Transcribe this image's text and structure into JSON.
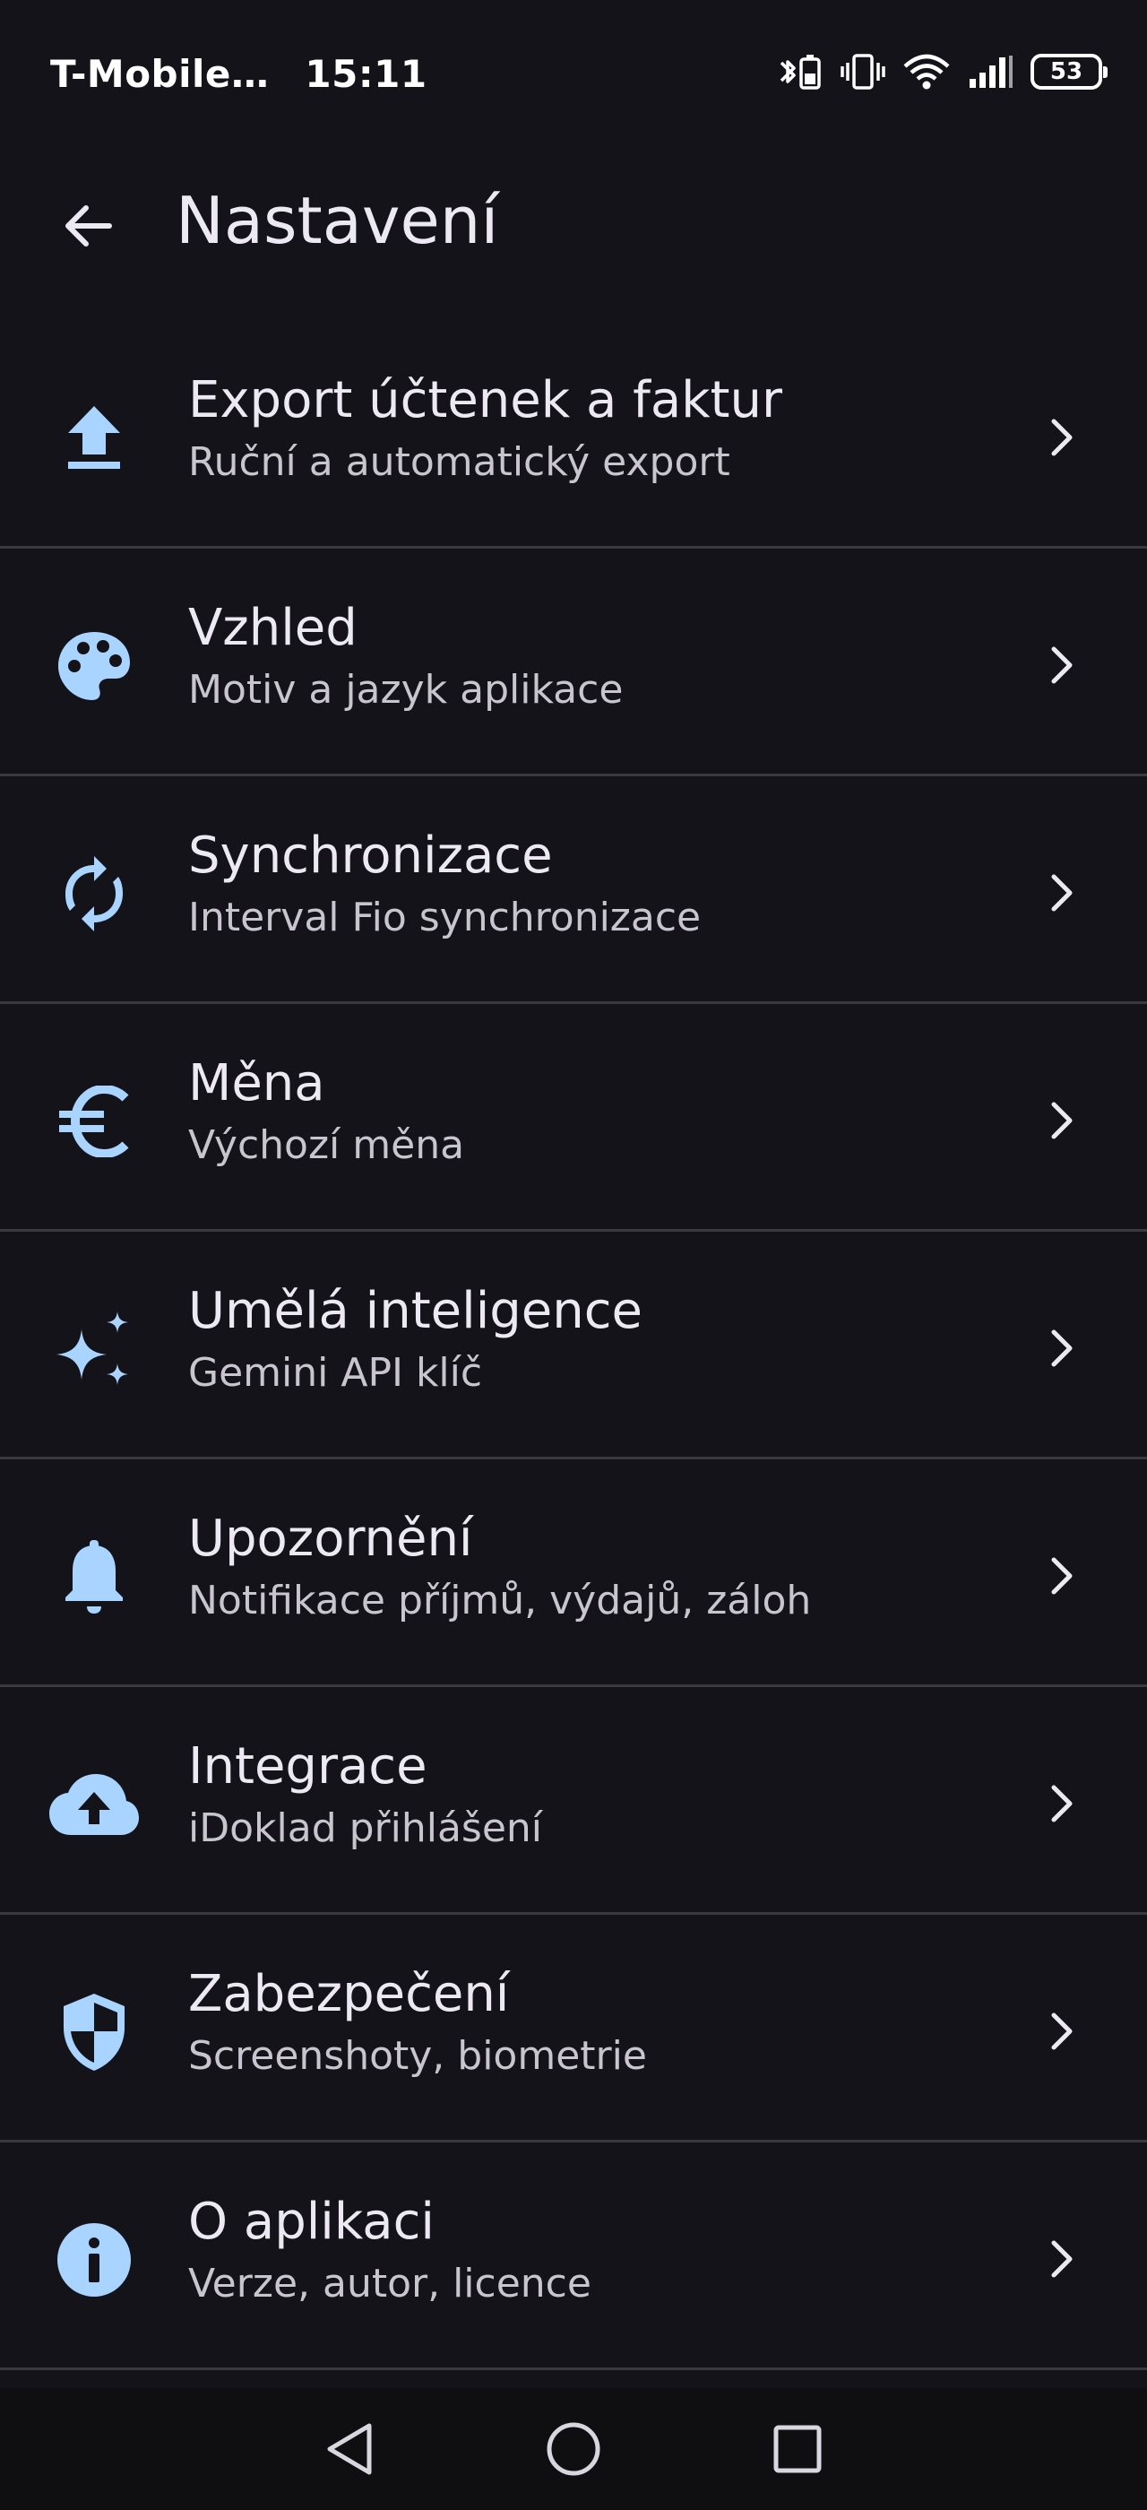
{
  "status_bar": {
    "carrier": "T-Mobile…",
    "time": "15:11",
    "battery": "53"
  },
  "app_bar": {
    "title": "Nastavení"
  },
  "settings": {
    "items": [
      {
        "title": "Export účtenek a faktur",
        "subtitle": "Ruční a automatický export",
        "icon": "upload-icon"
      },
      {
        "title": "Vzhled",
        "subtitle": "Motiv a jazyk aplikace",
        "icon": "palette-icon"
      },
      {
        "title": "Synchronizace",
        "subtitle": "Interval Fio synchronizace",
        "icon": "sync-icon"
      },
      {
        "title": "Měna",
        "subtitle": "Výchozí měna",
        "icon": "euro-icon"
      },
      {
        "title": "Umělá inteligence",
        "subtitle": "Gemini API klíč",
        "icon": "sparkles-icon"
      },
      {
        "title": "Upozornění",
        "subtitle": "Notifikace příjmů, výdajů, záloh",
        "icon": "bell-icon"
      },
      {
        "title": "Integrace",
        "subtitle": "iDoklad přihlášení",
        "icon": "cloud-upload-icon"
      },
      {
        "title": "Zabezpečení",
        "subtitle": "Screenshoty, biometrie",
        "icon": "shield-icon"
      },
      {
        "title": "O aplikaci",
        "subtitle": "Verze, autor, licence",
        "icon": "info-icon"
      }
    ]
  },
  "colors": {
    "background": "#14131a",
    "icon_accent": "#a8d4ff",
    "divider": "#3a3940",
    "nav_background": "#0f0f12"
  }
}
